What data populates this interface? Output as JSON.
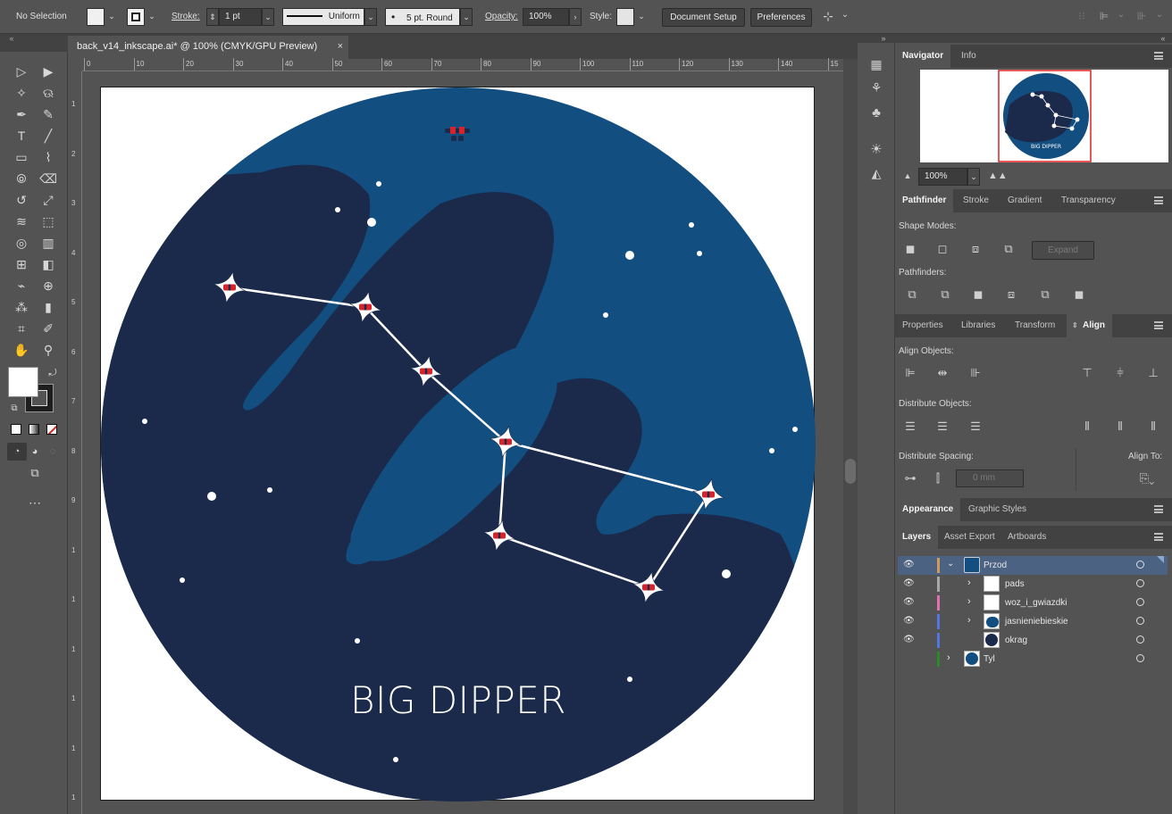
{
  "control_bar": {
    "selection": "No Selection",
    "stroke_label": "Stroke:",
    "stroke_weight": "1 pt",
    "stroke_profile": "Uniform",
    "brush": "5 pt. Round",
    "opacity_label": "Opacity:",
    "opacity_value": "100%",
    "style_label": "Style:",
    "document_setup": "Document Setup",
    "preferences": "Preferences"
  },
  "document_tab": {
    "title": "back_v14_inkscape.ai* @ 100% (CMYK/GPU Preview)",
    "close": "×"
  },
  "rulers": {
    "horizontal": [
      "0",
      "10",
      "20",
      "30",
      "40",
      "50",
      "60",
      "70",
      "80",
      "90",
      "100",
      "110",
      "120",
      "130",
      "140",
      "15"
    ],
    "vertical": [
      "1",
      "2",
      "3",
      "4",
      "5",
      "6",
      "7",
      "8",
      "9",
      "1",
      "1",
      "1",
      "1",
      "1",
      "1"
    ]
  },
  "artwork": {
    "title": "BIG DIPPER",
    "colors": {
      "light_blue": "#134e80",
      "dark_blue": "#1b2a4a",
      "star_red": "#d8232a",
      "white": "#ffffff"
    }
  },
  "navigator": {
    "tabs": [
      "Navigator",
      "Info"
    ],
    "zoom": "100%",
    "thumb_text": "BIG DIPPER"
  },
  "pathfinder": {
    "tabs": [
      "Pathfinder",
      "Stroke",
      "Gradient",
      "Transparency"
    ],
    "shape_modes": "Shape Modes:",
    "expand": "Expand",
    "pathfinders": "Pathfinders:"
  },
  "align": {
    "tabs": [
      "Properties",
      "Libraries",
      "Transform",
      "Align"
    ],
    "align_objects": "Align Objects:",
    "distribute_objects": "Distribute Objects:",
    "distribute_spacing": "Distribute Spacing:",
    "align_to": "Align To:",
    "spacing_value": "0 mm"
  },
  "appearance": {
    "tabs": [
      "Appearance",
      "Graphic Styles"
    ]
  },
  "layers_panel": {
    "tabs": [
      "Layers",
      "Asset Export",
      "Artboards"
    ],
    "layers": [
      {
        "name": "Przod",
        "color": "#d09a5a"
      },
      {
        "name": "pads",
        "color": "#a8a8a8"
      },
      {
        "name": "woz_i_gwiazdki",
        "color": "#e070b0"
      },
      {
        "name": "jasnieniebieskie",
        "color": "#5078e0"
      },
      {
        "name": "okrag",
        "color": "#5078e0"
      },
      {
        "name": "Tyl",
        "color": "#2a8a2a"
      }
    ]
  }
}
